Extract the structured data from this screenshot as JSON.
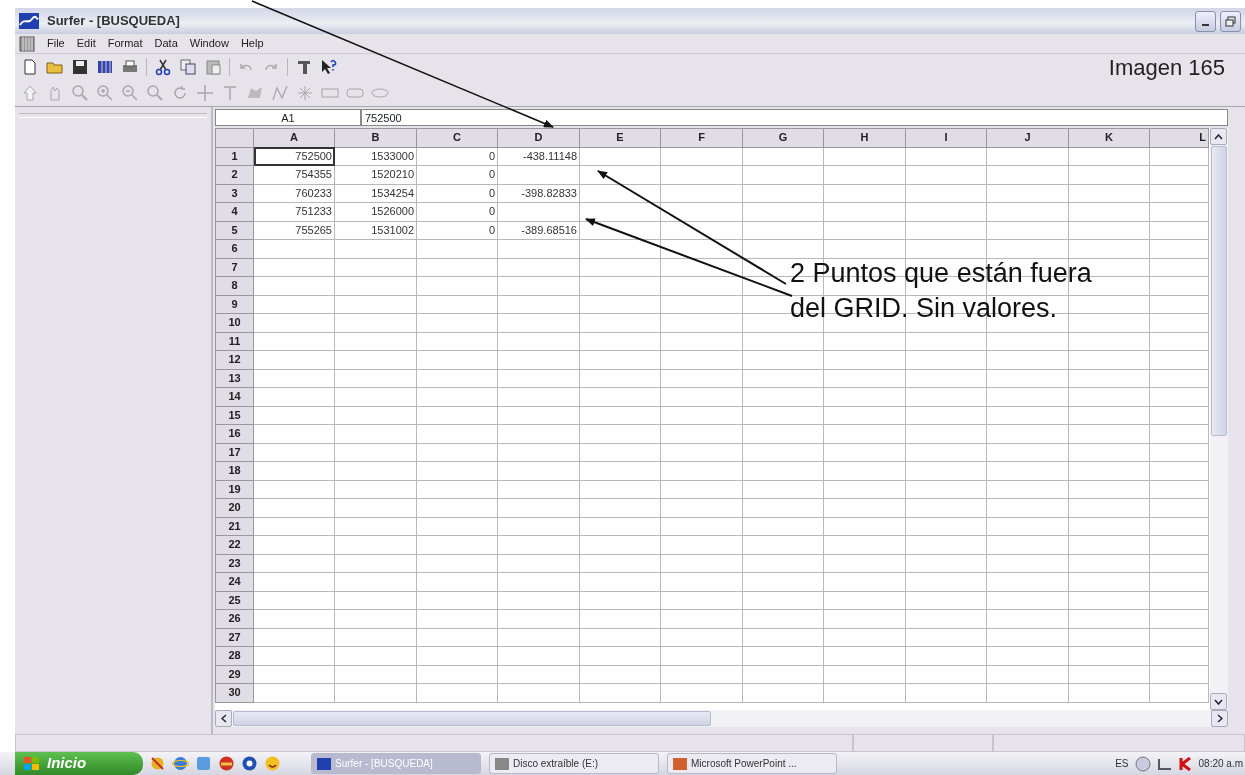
{
  "window": {
    "title": "Surfer - [BUSQUEDA]"
  },
  "menu": [
    "File",
    "Edit",
    "Format",
    "Data",
    "Window",
    "Help"
  ],
  "caption": "Imagen 165",
  "cell_ref": {
    "cell": "A1",
    "value": "752500"
  },
  "grid": {
    "columns": [
      "A",
      "B",
      "C",
      "D",
      "E",
      "F",
      "G",
      "H",
      "I",
      "J",
      "K",
      "L"
    ],
    "rows": [
      {
        "header": "1",
        "cells": [
          {
            "value": "752500",
            "selected": true
          },
          {
            "value": "1533000",
            "selected": false
          },
          {
            "value": "0",
            "selected": false
          },
          {
            "value": "-438.11148",
            "selected": false
          }
        ]
      },
      {
        "header": "2",
        "cells": [
          {
            "value": "754355",
            "selected": false
          },
          {
            "value": "1520210",
            "selected": false
          },
          {
            "value": "0",
            "selected": false
          }
        ]
      },
      {
        "header": "3",
        "cells": [
          {
            "value": "760233",
            "selected": false
          },
          {
            "value": "1534254",
            "selected": false
          },
          {
            "value": "0",
            "selected": false
          },
          {
            "value": "-398.82833",
            "selected": false
          }
        ]
      },
      {
        "header": "4",
        "cells": [
          {
            "value": "751233",
            "selected": false
          },
          {
            "value": "1526000",
            "selected": false
          },
          {
            "value": "0",
            "selected": false
          }
        ]
      },
      {
        "header": "5",
        "cells": [
          {
            "value": "755265",
            "selected": false
          },
          {
            "value": "1531002",
            "selected": false
          },
          {
            "value": "0",
            "selected": false
          },
          {
            "value": "-389.68516",
            "selected": false
          }
        ]
      },
      {
        "header": "6"
      },
      {
        "header": "7"
      },
      {
        "header": "8"
      },
      {
        "header": "9"
      },
      {
        "header": "10"
      },
      {
        "header": "11"
      },
      {
        "header": "12"
      },
      {
        "header": "13"
      },
      {
        "header": "14"
      },
      {
        "header": "15"
      },
      {
        "header": "16"
      },
      {
        "header": "17"
      },
      {
        "header": "18"
      },
      {
        "header": "19"
      },
      {
        "header": "20"
      },
      {
        "header": "21"
      },
      {
        "header": "22"
      },
      {
        "header": "23"
      },
      {
        "header": "24"
      },
      {
        "header": "25"
      },
      {
        "header": "26"
      },
      {
        "header": "27"
      },
      {
        "header": "28"
      },
      {
        "header": "29"
      },
      {
        "header": "30"
      }
    ]
  },
  "annotation": {
    "lines": [
      "2 Puntos que están fuera",
      "del GRID. Sin valores."
    ]
  },
  "taskbar": {
    "start": "Inicio",
    "tasks": [
      {
        "label": "Surfer - [BUSQUEDA]",
        "selected": true
      },
      {
        "label": "Disco extraíble (E:)",
        "selected": false
      },
      {
        "label": "Microsoft PowerPoint ...",
        "selected": false
      }
    ],
    "language": "ES",
    "clock": "08:20 a.m"
  }
}
